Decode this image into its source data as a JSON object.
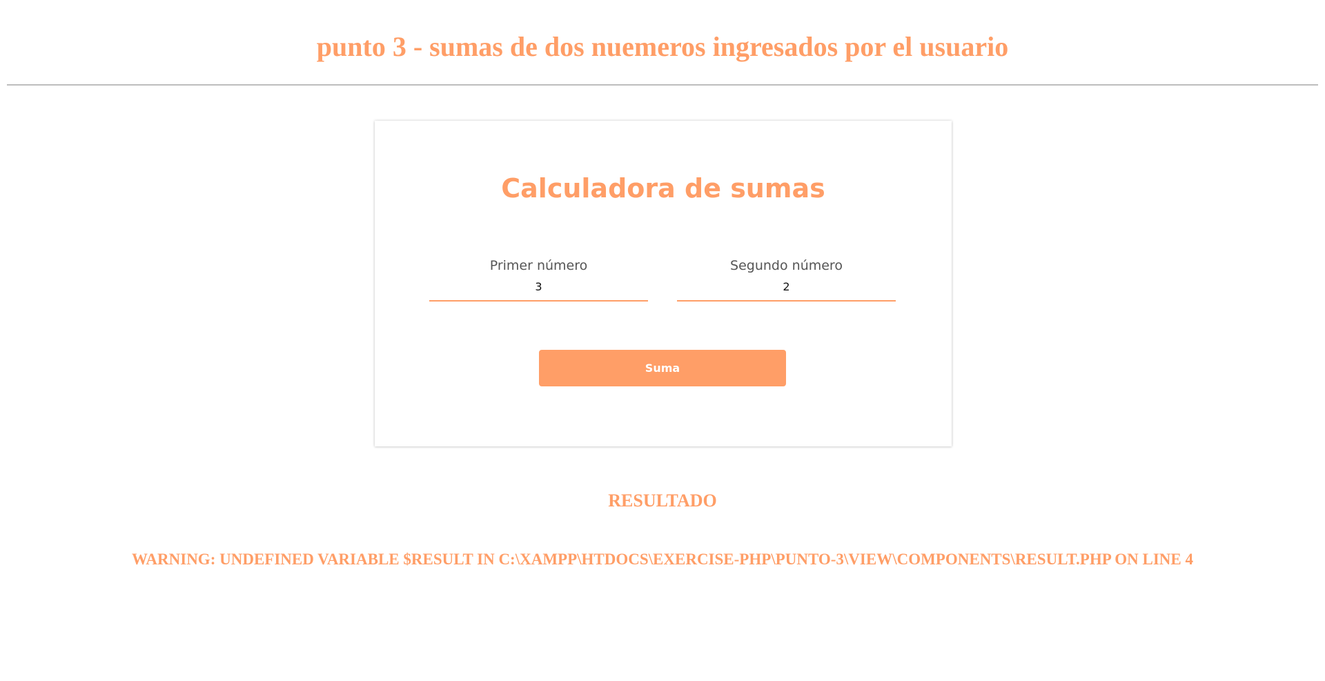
{
  "page": {
    "title": "punto 3 - sumas de dos nuemeros ingresados por el usuario",
    "accent_color": "#ff9e67",
    "divider_color": "#bdbdbd"
  },
  "calculator": {
    "title": "Calculadora de sumas",
    "first_field": {
      "label": "Primer número",
      "value": "3"
    },
    "second_field": {
      "label": "Segundo número",
      "value": "2"
    },
    "submit_label": "Suma"
  },
  "result": {
    "heading": "RESULTADO",
    "message": "WARNING: UNDEFINED VARIABLE $RESULT IN C:\\XAMPP\\HTDOCS\\EXERCISE-PHP\\PUNTO-3\\VIEW\\COMPONENTS\\RESULT.PHP ON LINE 4"
  }
}
